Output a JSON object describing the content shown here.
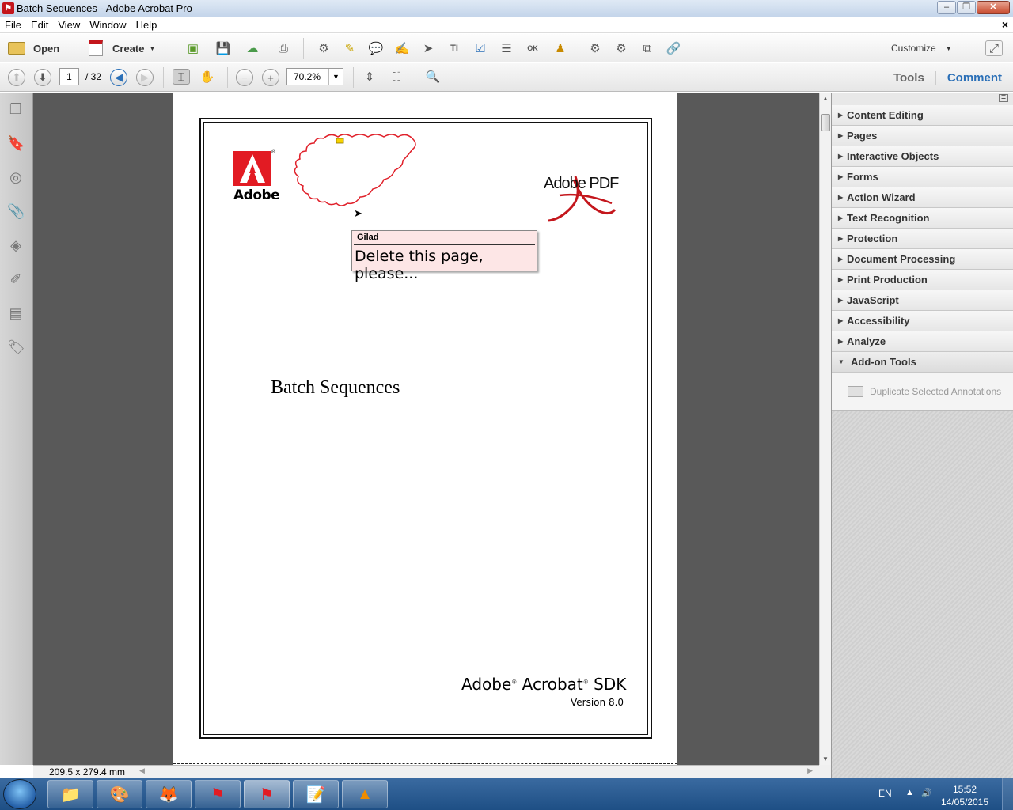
{
  "window": {
    "title": "Batch Sequences - Adobe Acrobat Pro",
    "min": "–",
    "max": "❐",
    "close": "✕"
  },
  "menu": {
    "items": [
      "File",
      "Edit",
      "View",
      "Window",
      "Help"
    ],
    "doc_close": "×"
  },
  "toolbar": {
    "open_label": "Open",
    "create_label": "Create",
    "customize_label": "Customize"
  },
  "nav": {
    "page_current": "1",
    "page_total": "/ 32",
    "zoom": "70.2%"
  },
  "tabs": {
    "tools": "Tools",
    "comment": "Comment"
  },
  "document": {
    "adobe_word": "Adobe",
    "pdf_logo_text": "Adobe PDF",
    "comment_author": "Gilad",
    "comment_text": "Delete this page, please...",
    "title": "Batch Sequences",
    "sdk_adobe": "Adobe",
    "sdk_acrobat": "Acrobat",
    "sdk_suffix": "SDK",
    "version": "Version 8.0"
  },
  "status": {
    "dimensions": "209.5 x 279.4 mm"
  },
  "panel": {
    "items": [
      "Content Editing",
      "Pages",
      "Interactive Objects",
      "Forms",
      "Action Wizard",
      "Text Recognition",
      "Protection",
      "Document Processing",
      "Print Production",
      "JavaScript",
      "Accessibility",
      "Analyze",
      "Add-on Tools"
    ],
    "addon_tool": "Duplicate Selected Annotations"
  },
  "taskbar": {
    "lang": "EN",
    "time": "15:52",
    "date": "14/05/2015"
  },
  "colors": {
    "accent": "#2a6fb7",
    "adobe_red": "#e21b23",
    "cloud_red": "#e0202a"
  }
}
